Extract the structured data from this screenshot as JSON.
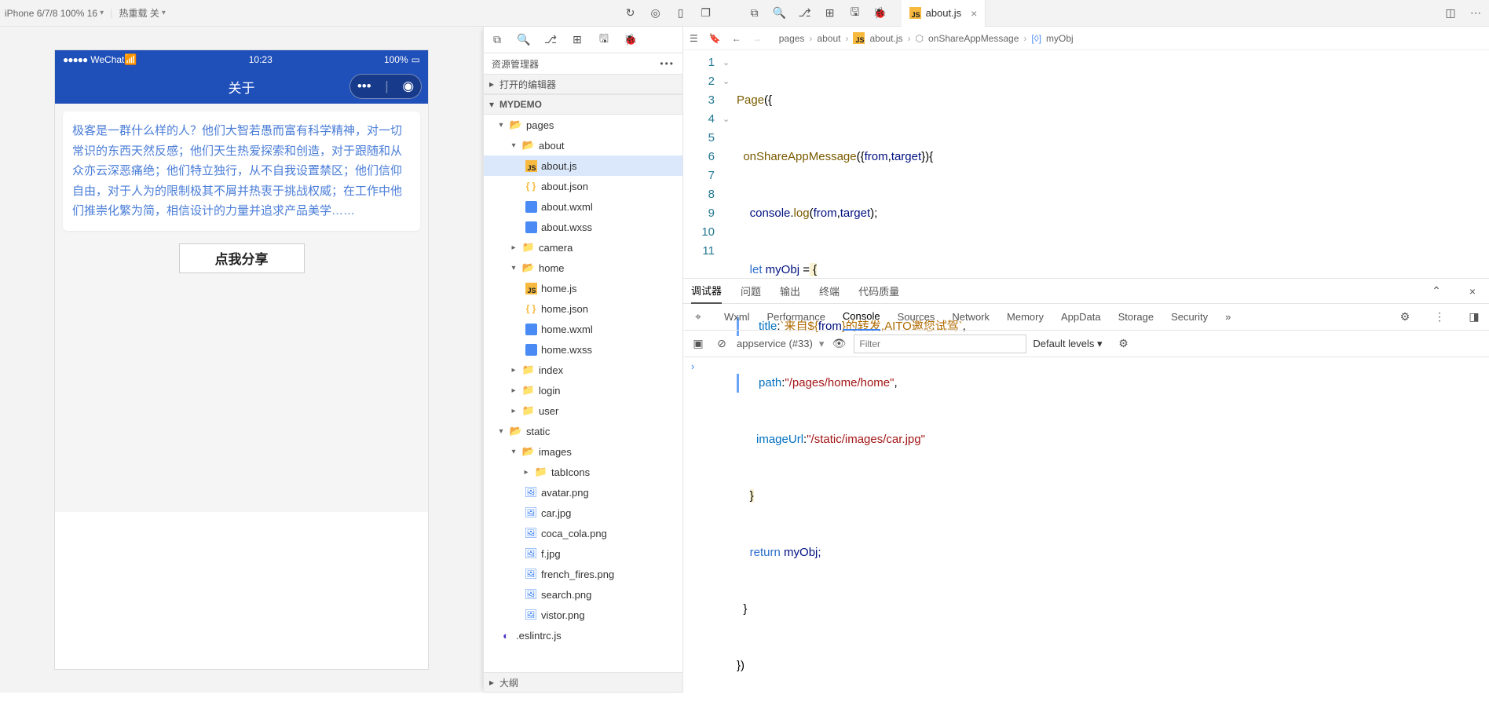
{
  "topbar": {
    "device": "iPhone 6/7/8 100% 16",
    "hotReload": "热重载 关"
  },
  "tab": {
    "filename": "about.js"
  },
  "breadcrumb": {
    "seg1": "pages",
    "seg2": "about",
    "seg3": "about.js",
    "seg4": "onShareAppMessage",
    "seg5": "myObj"
  },
  "explorer": {
    "title": "资源管理器",
    "openEditors": "打开的编辑器",
    "project": "MYDEMO",
    "outline": "大纲",
    "nodes": {
      "pages": "pages",
      "about": "about",
      "aboutjs": "about.js",
      "aboutjson": "about.json",
      "aboutwxml": "about.wxml",
      "aboutwxss": "about.wxss",
      "camera": "camera",
      "home": "home",
      "homejs": "home.js",
      "homejson": "home.json",
      "homewxml": "home.wxml",
      "homewxss": "home.wxss",
      "index": "index",
      "login": "login",
      "user": "user",
      "static": "static",
      "images": "images",
      "tabicons": "tabIcons",
      "avatar": "avatar.png",
      "car": "car.jpg",
      "coca": "coca_cola.png",
      "f": "f.jpg",
      "french": "french_fires.png",
      "search": "search.png",
      "vistor": "vistor.png",
      "eslint": ".eslintrc.js"
    }
  },
  "phone": {
    "carrier": "WeChat",
    "time": "10:23",
    "battery": "100%",
    "title": "关于",
    "about": "极客是一群什么样的人？他们大智若愚而富有科学精神，对一切常识的东西天然反感；他们天生热爱探索和创造，对于跟随和从众亦云深恶痛绝；他们特立独行，从不自我设置禁区；他们信仰自由，对于人为的限制极其不屑并热衷于挑战权威；在工作中他们推崇化繁为简，相信设计的力量并追求产品美学……",
    "shareBtn": "点我分享"
  },
  "code": {
    "l1": {
      "a": "Page",
      "b": "({"
    },
    "l2": {
      "a": "onShareAppMessage",
      "b": "({",
      "c": "from",
      "d": ",",
      "e": "target",
      "f": "}){"
    },
    "l3": {
      "a": "console",
      "b": ".",
      "c": "log",
      "d": "(",
      "e": "from",
      "f": ",",
      "g": "target",
      "h": ");"
    },
    "l4": {
      "a": "let",
      "b": " myObj ",
      "c": "=",
      "d": " {"
    },
    "l5": {
      "a": "title",
      "b": ":",
      "c": "`来自${",
      "d": "from",
      "e": "}的转发,AITO邀您试驾`",
      "f": ","
    },
    "l6": {
      "a": "path",
      "b": ":",
      "c": "\"/pages/home/home\"",
      "d": ","
    },
    "l7": {
      "a": "imageUrl",
      "b": ":",
      "c": "\"/static/images/car.jpg\""
    },
    "l8": {
      "a": "}"
    },
    "l9": {
      "a": "return",
      "b": " myObj;"
    },
    "l10": {
      "a": "}"
    },
    "l11": {
      "a": "})"
    }
  },
  "panel": {
    "tabs": {
      "debug": "调试器",
      "issues": "问题",
      "output": "输出",
      "terminal": "终端",
      "quality": "代码质量"
    },
    "dev": {
      "wxml": "Wxml",
      "perf": "Performance",
      "console": "Console",
      "sources": "Sources",
      "network": "Network",
      "memory": "Memory",
      "appdata": "AppData",
      "storage": "Storage",
      "security": "Security"
    },
    "context": "appservice (#33)",
    "filterPlaceholder": "Filter",
    "levels": "Default levels ▾",
    "prompt": "›"
  }
}
